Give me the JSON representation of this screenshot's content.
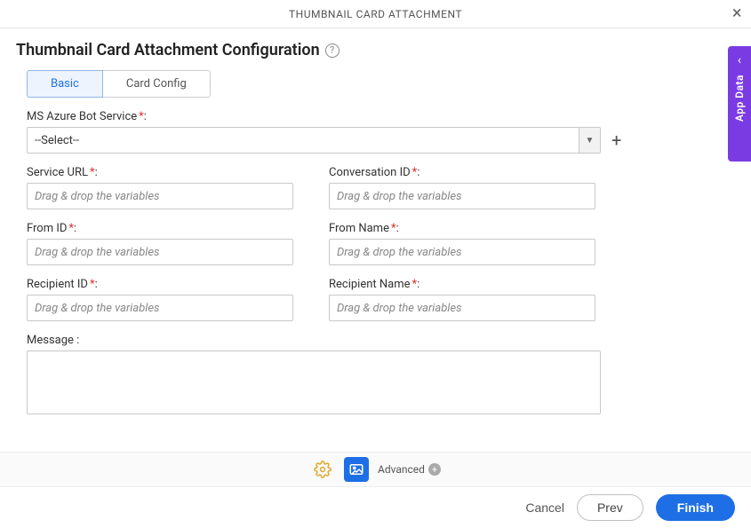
{
  "header": {
    "title": "THUMBNAIL CARD ATTACHMENT"
  },
  "page_title": "Thumbnail Card Attachment Configuration",
  "tabs": {
    "basic": "Basic",
    "card_config": "Card Config"
  },
  "fields": {
    "azure": {
      "label": "MS Azure Bot Service",
      "value": "--Select--"
    },
    "service_url": {
      "label": "Service URL",
      "placeholder": "Drag & drop the variables"
    },
    "conversation_id": {
      "label": "Conversation ID",
      "placeholder": "Drag & drop the variables"
    },
    "from_id": {
      "label": "From ID",
      "placeholder": "Drag & drop the variables"
    },
    "from_name": {
      "label": "From Name",
      "placeholder": "Drag & drop the variables"
    },
    "recipient_id": {
      "label": "Recipient ID",
      "placeholder": "Drag & drop the variables"
    },
    "recipient_name": {
      "label": "Recipient Name",
      "placeholder": "Drag & drop the variables"
    },
    "message": {
      "label": "Message :"
    }
  },
  "toolbar": {
    "advanced": "Advanced"
  },
  "footer": {
    "cancel": "Cancel",
    "prev": "Prev",
    "finish": "Finish"
  },
  "side": {
    "label": "App Data"
  },
  "glyphs": {
    "required": " *",
    "colon": ":"
  }
}
